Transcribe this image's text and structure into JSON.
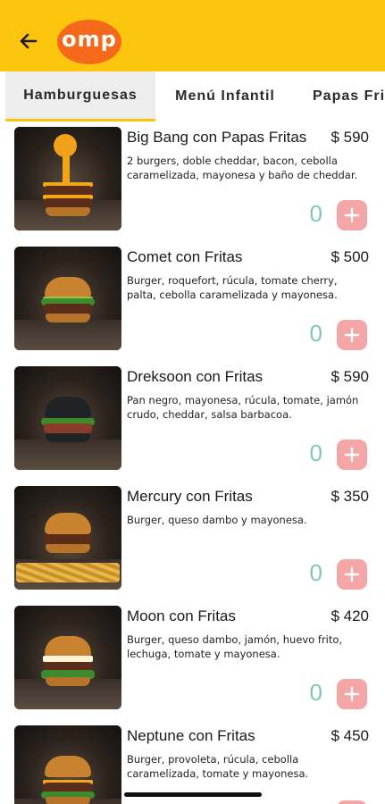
{
  "header": {
    "logo_text": "omp",
    "back_icon": "arrow-left-icon",
    "bg_color": "#FDC40E",
    "logo_color": "#F56A1A"
  },
  "tabs": [
    {
      "label": "Hamburguesas",
      "active": true
    },
    {
      "label": "Menú Infantil",
      "active": false
    },
    {
      "label": "Papas Fri",
      "active": false
    }
  ],
  "products": [
    {
      "name": "Big Bang con Papas Fritas",
      "price": "$ 590",
      "desc": "2 burgers, doble cheddar, bacon, cebolla caramelizada, mayonesa y baño de cheddar.",
      "qty": "0"
    },
    {
      "name": "Comet con Fritas",
      "price": "$ 500",
      "desc": "Burger, roquefort, rúcula, tomate cherry, palta, cebolla caramelizada y mayonesa.",
      "qty": "0"
    },
    {
      "name": "Dreksoon con Fritas",
      "price": "$ 590",
      "desc": "Pan negro, mayonesa, rúcula, tomate, jamón crudo, cheddar, salsa barbacoa.",
      "qty": "0"
    },
    {
      "name": "Mercury con Fritas",
      "price": "$ 350",
      "desc": "Burger, queso dambo y mayonesa.",
      "qty": "0"
    },
    {
      "name": "Moon con Fritas",
      "price": "$ 420",
      "desc": "Burger, queso dambo, jamón, huevo frito, lechuga, tomate y mayonesa.",
      "qty": "0"
    },
    {
      "name": "Neptune con Fritas",
      "price": "$ 450",
      "desc": "Burger, provoleta, rúcula, cebolla caramelizada, tomate y mayonesa.",
      "qty": "0"
    }
  ],
  "colors": {
    "qty": "#7ECBB0",
    "add_button": "#F4A5A5",
    "tab_active_bg": "#EDEDED"
  }
}
